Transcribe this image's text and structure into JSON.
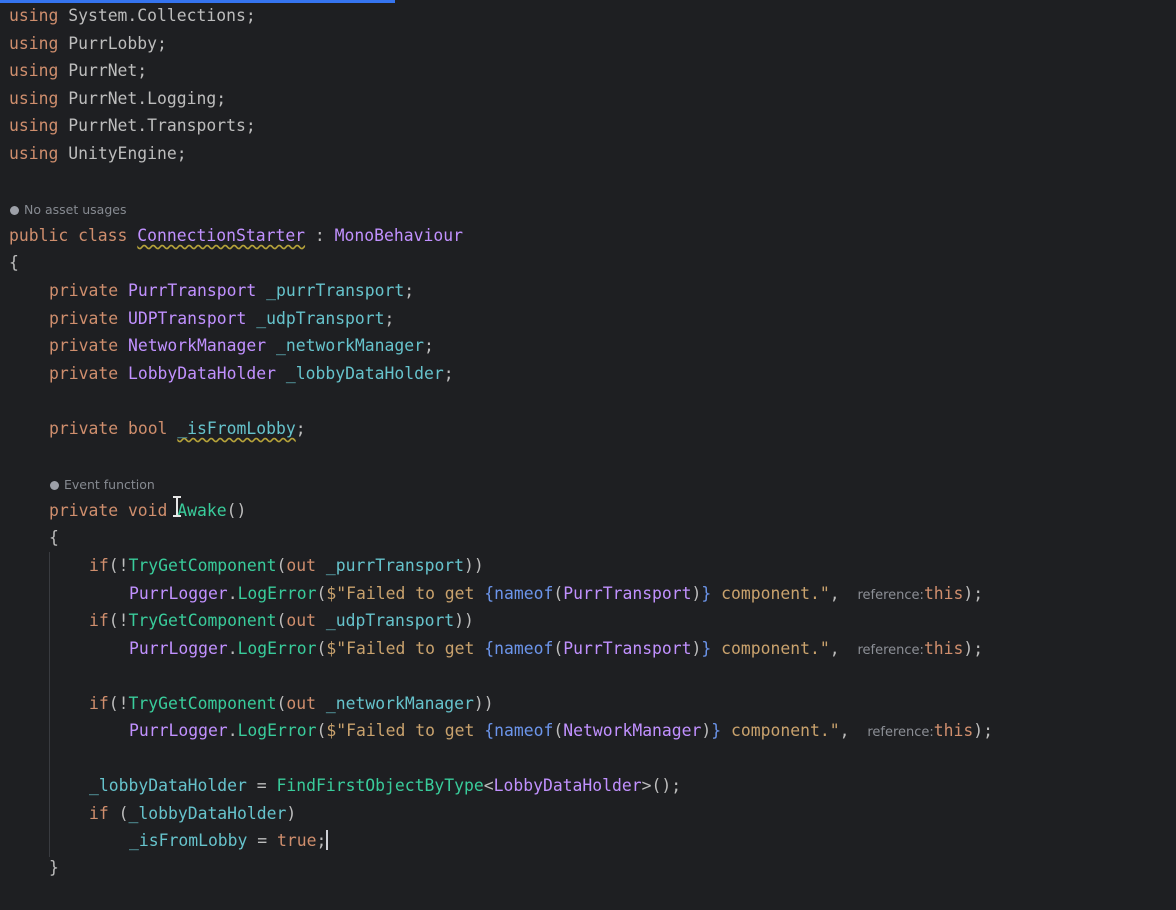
{
  "code": {
    "using_keyword": "using",
    "usings": [
      "System.Collections",
      "PurrLobby",
      "PurrNet",
      "PurrNet.Logging",
      "PurrNet.Transports",
      "UnityEngine"
    ],
    "semicolon": ";",
    "hint_no_asset_usages": "No asset usages",
    "class_modifiers": "public class",
    "class_name": "ConnectionStarter",
    "class_colon": " : ",
    "base_class": "MonoBehaviour",
    "open_brace": "{",
    "close_brace": "}",
    "fields": [
      {
        "modifier": "private",
        "type": "PurrTransport",
        "name": "_purrTransport"
      },
      {
        "modifier": "private",
        "type": "UDPTransport",
        "name": "_udpTransport"
      },
      {
        "modifier": "private",
        "type": "NetworkManager",
        "name": "_networkManager"
      },
      {
        "modifier": "private",
        "type": "LobbyDataHolder",
        "name": "_lobbyDataHolder"
      }
    ],
    "bool_field": {
      "modifier": "private",
      "type": "bool",
      "name": "_isFromLobby"
    },
    "hint_event_function": "Event function",
    "method_modifiers": "private void",
    "method_name": "Awake",
    "method_parens": "()",
    "if_blocks": [
      {
        "field": "_purrTransport",
        "nameof_type": "PurrTransport"
      },
      {
        "field": "_udpTransport",
        "nameof_type": "PurrTransport"
      },
      {
        "field": "_networkManager",
        "nameof_type": "NetworkManager"
      }
    ],
    "if_keyword": "if",
    "try_get": "TryGetComponent",
    "out_keyword": "out",
    "logger_class": "PurrLogger",
    "log_method": "LogError",
    "str_prefix": "$\"Failed to get ",
    "nameof_keyword": "nameof",
    "str_suffix": " component.\"",
    "inlay_reference": "reference:",
    "this_keyword": "this",
    "find_method": "FindFirstObjectByType",
    "find_type": "LobbyDataHolder",
    "assign_value": "true"
  }
}
